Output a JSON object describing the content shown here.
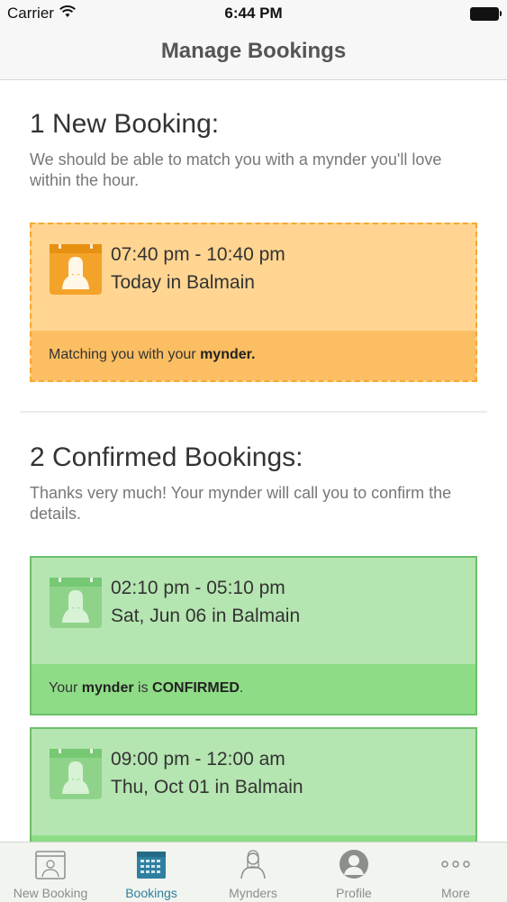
{
  "status_bar": {
    "carrier": "Carrier",
    "time": "6:44 PM"
  },
  "nav": {
    "title": "Manage Bookings"
  },
  "new_section": {
    "title": "1 New Booking:",
    "description": "We should be able to match you with a mynder you'll love within the hour.",
    "bookings": [
      {
        "time": "07:40 pm - 10:40 pm",
        "place": "Today in Balmain",
        "footer_pre": "Matching you with your ",
        "footer_bold": "mynder.",
        "footer_post": ""
      }
    ]
  },
  "confirmed_section": {
    "title": "2 Confirmed Bookings:",
    "description": "Thanks very much! Your mynder will call you to confirm the details.",
    "bookings": [
      {
        "time": "02:10 pm - 05:10 pm",
        "place": "Sat, Jun 06 in Balmain",
        "footer_pre": "Your ",
        "footer_bold": "mynder",
        "footer_mid": " is ",
        "footer_bold2": "CONFIRMED",
        "footer_post": "."
      },
      {
        "time": "09:00 pm - 12:00 am",
        "place": "Thu, Oct 01 in Balmain"
      }
    ]
  },
  "tabs": [
    {
      "label": "New Booking",
      "icon": "new-booking-icon"
    },
    {
      "label": "Bookings",
      "icon": "calendar-icon",
      "active": true
    },
    {
      "label": "Mynders",
      "icon": "mynder-icon"
    },
    {
      "label": "Profile",
      "icon": "profile-icon"
    },
    {
      "label": "More",
      "icon": "more-icon"
    }
  ],
  "colors": {
    "pending_bg": "#ffd591",
    "pending_border": "#f5a831",
    "confirmed_bg": "#b5e5b1",
    "confirmed_border": "#6cbf69",
    "tab_active": "#2f7fa0"
  }
}
